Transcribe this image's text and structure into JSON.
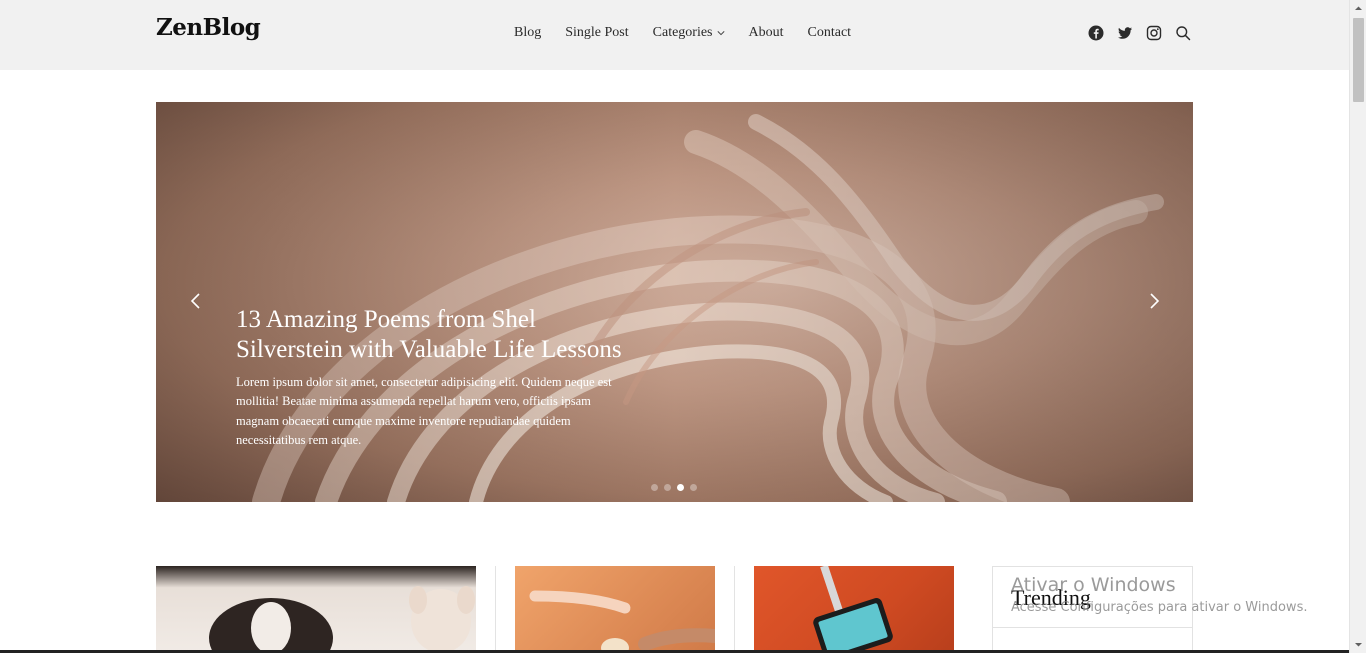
{
  "header": {
    "logo": "ZenBlog",
    "nav": [
      "Blog",
      "Single Post",
      "Categories",
      "About",
      "Contact"
    ],
    "social_icons": [
      "facebook-icon",
      "twitter-icon",
      "instagram-icon",
      "search-icon"
    ]
  },
  "hero": {
    "title": "13 Amazing Poems from Shel Silverstein with Valuable Life Lessons",
    "excerpt": "Lorem ipsum dolor sit amet, consectetur adipisicing elit. Quidem neque est mollitia! Beatae minima assumenda repellat harum vero, officiis ipsam magnam obcaecati cumque maxime inventore repudiandae quidem necessitatibus rem atque.",
    "slide_count": 4,
    "active_slide": 3,
    "colors": {
      "accent": "#c49c88",
      "dark": "#6e4f42"
    }
  },
  "sidebar": {
    "trending_title": "Trending"
  },
  "watermark": {
    "line1": "Ativar o Windows",
    "line2": "Acesse Configurações para ativar o Windows."
  }
}
